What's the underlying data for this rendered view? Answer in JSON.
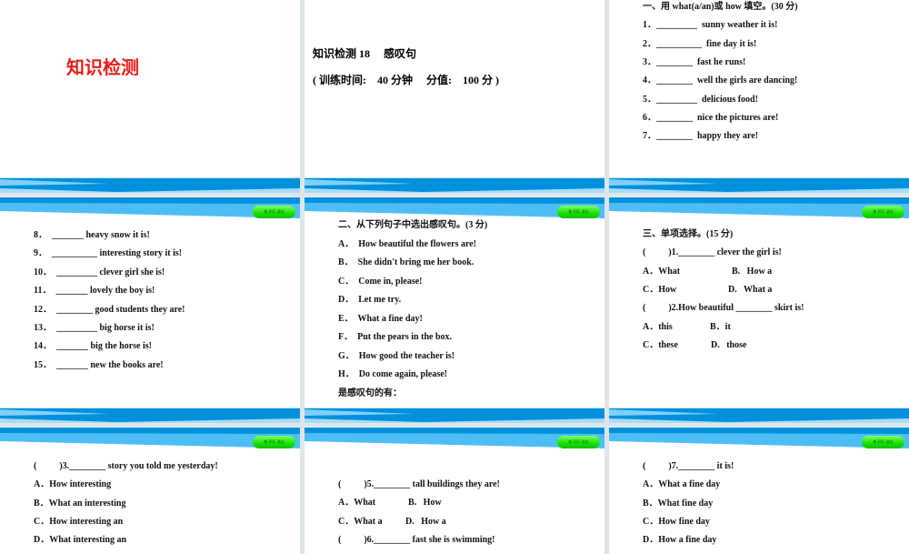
{
  "esc_button_label": "按 ESC 退出",
  "colors": {
    "band_dark": "#0090dc",
    "band_light": "#4dbef5",
    "title_red": "#e8201c",
    "esc_green": "#18e000"
  },
  "slide1": {
    "title": "知识检测"
  },
  "slide2": {
    "title": "知识检测 18　 感叹句",
    "subtitle": "( 训练时间:　40 分钟　 分值:　100 分 )"
  },
  "slides": [
    {
      "lines": [
        {
          "a": "一、用 what(a/an)或 how 填空。(30 分)"
        },
        {
          "a": "1．_________  sunny weather it is!"
        },
        {
          "a": "2．__________  fine day it is!"
        },
        {
          "a": "3．________  fast he runs!"
        },
        {
          "a": "4．________  well the girls are dancing!"
        },
        {
          "a": "5．_________  delicious food!"
        },
        {
          "a": "6．________  nice the pictures are!"
        },
        {
          "a": "7．________  happy they are!"
        }
      ]
    },
    {
      "lines": [
        {
          "a": "8．  _______ heavy snow it is!"
        },
        {
          "a": "9．  __________ interesting story it is!"
        },
        {
          "a": "10．  _________ clever girl she is!"
        },
        {
          "a": "11．  _______ lovely the boy is!"
        },
        {
          "a": "12．  ________ good students they are!"
        },
        {
          "a": "13．  _________ big horse it is!"
        },
        {
          "a": "14．  _______ big the horse is!"
        },
        {
          "a": "15．  _______ new the books are!"
        }
      ]
    },
    {
      "lines": [
        {
          "a": "二、从下列句子中选出感叹句。(3 分)"
        },
        {
          "a": "A．  How beautiful the flowers are!"
        },
        {
          "a": "B．  She didn't bring me her book."
        },
        {
          "a": "C．  Come in, please!"
        },
        {
          "a": "D．  Let me try."
        },
        {
          "a": "E．  What a fine day!"
        },
        {
          "a": "F．  Put the pears in the box."
        },
        {
          "a": "G．  How good the teacher is!"
        },
        {
          "a": "H．  Do come again, please!"
        },
        {
          "a": "是感叹句的有："
        }
      ]
    },
    {
      "lines": [
        {
          "a": "三、单项选择。(15 分)"
        },
        {
          "a": "(          )1.________ clever the girl is!"
        },
        {
          "a": "A．What",
          "b": "B.   How a"
        },
        {
          "a": "C．How",
          "b": "D.   What a"
        },
        {
          "a": "(          )2.How beautiful ________ skirt is!"
        },
        {
          "a": "A．this",
          "b": "B．it"
        },
        {
          "a": "C．these",
          "b": "D.   those"
        }
      ]
    },
    {
      "lines": [
        {
          "a": "(          )3.________ story you told me yesterday!"
        },
        {
          "a": "A．How interesting"
        },
        {
          "a": "B．What an interesting"
        },
        {
          "a": "C．How interesting an"
        },
        {
          "a": "D．What interesting an"
        }
      ]
    },
    {
      "lines": [
        {
          "a": "(          )5.________ tall buildings they are!"
        },
        {
          "a": "A．What",
          "b": "B.   How"
        },
        {
          "a": "C．What a",
          "b": "D.   How a"
        },
        {
          "a": "(          )6.________ fast she is swimming!"
        }
      ]
    },
    {
      "lines": [
        {
          "a": "(          )7.________ it is!"
        },
        {
          "a": "A．What a fine day"
        },
        {
          "a": "B．What fine day"
        },
        {
          "a": "C．How fine day"
        },
        {
          "a": "D．How a fine day"
        }
      ]
    }
  ]
}
